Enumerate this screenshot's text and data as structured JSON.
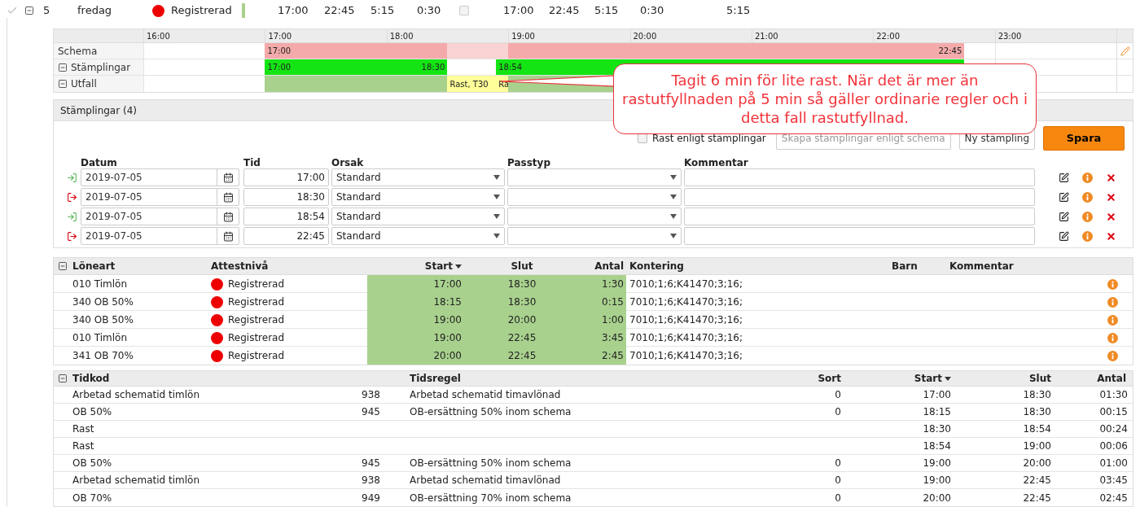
{
  "day_row": {
    "number": "5",
    "weekday": "fredag",
    "status": {
      "label": "Registrerad",
      "color": "#ee0000"
    },
    "times": [
      "17:00",
      "22:45",
      "5:15",
      "0:30"
    ],
    "checked": false,
    "times_2": [
      "17:00",
      "22:45",
      "5:15",
      "0:30"
    ],
    "total": "5:15"
  },
  "timeline": {
    "hours": [
      "16:00",
      "17:00",
      "18:00",
      "19:00",
      "20:00",
      "21:00",
      "22:00",
      "23:00"
    ],
    "rows": [
      {
        "label": "Schema",
        "collapsible": false,
        "segments": [
          {
            "kind": "schema",
            "label_start": "17:00"
          },
          {
            "kind": "schema_gap"
          },
          {
            "kind": "schema",
            "label_end": "22:45"
          }
        ]
      },
      {
        "label": "Stämplingar",
        "collapsible": true,
        "segments": [
          {
            "kind": "stamp",
            "label_start": "17:00",
            "label_end": "18:30"
          },
          {
            "kind": "stamp",
            "label_start": "18:54"
          }
        ]
      },
      {
        "label": "Utfall",
        "collapsible": true,
        "segments": [
          {
            "kind": "worked"
          },
          {
            "kind": "break",
            "label_start": "Rast, T30"
          },
          {
            "kind": "break",
            "label_start": "Ra"
          },
          {
            "kind": "worked"
          }
        ]
      }
    ]
  },
  "callout": {
    "text": "Tagit 6 min för lite rast. När det är mer än rastutfyllnaden på 5 min så gäller ordinarie regler och i detta fall rastutfyllnad."
  },
  "stamplingar": {
    "title": "Stämplingar (4)",
    "rast_checkbox": {
      "label": "Rast enligt stämplingar",
      "checked": false
    },
    "buttons": [
      {
        "label": "Skapa stämplingar enligt schema",
        "kind": "disabled"
      },
      {
        "label": "Ny stämpling",
        "kind": "secondary"
      },
      {
        "label": "Spara",
        "kind": "primary"
      }
    ],
    "columns": [
      "Datum",
      "Tid",
      "Orsak",
      "Passtyp",
      "Kommentar"
    ],
    "rows": [
      {
        "kind": "in",
        "date": "2019-07-05",
        "time": "17:00",
        "reason": "Standard"
      },
      {
        "kind": "out",
        "date": "2019-07-05",
        "time": "18:30",
        "reason": "Standard"
      },
      {
        "kind": "in",
        "date": "2019-07-05",
        "time": "18:54",
        "reason": "Standard"
      },
      {
        "kind": "out",
        "date": "2019-07-05",
        "time": "22:45",
        "reason": "Standard"
      }
    ]
  },
  "loneart": {
    "columns": [
      {
        "label": "Löneart",
        "sorted": false
      },
      {
        "label": "Attestnivå",
        "sorted": false
      },
      {
        "label": "Start",
        "sorted": true
      },
      {
        "label": "Slut",
        "sorted": false
      },
      {
        "label": "Antal",
        "sorted": false
      },
      {
        "label": "Kontering",
        "sorted": false
      },
      {
        "label": "Barn",
        "sorted": false
      },
      {
        "label": "Kommentar",
        "sorted": false
      }
    ],
    "rows": [
      {
        "code": "010 Timlön",
        "status": {
          "label": "Registrerad",
          "color": "#ee0000"
        },
        "start": "17:00",
        "slut": "18:30",
        "antal": "1:30",
        "kontering": "7010;1;6;K41470;3;16;"
      },
      {
        "code": "340 OB 50%",
        "status": {
          "label": "Registrerad",
          "color": "#ee0000"
        },
        "start": "18:15",
        "slut": "18:30",
        "antal": "0:15",
        "kontering": "7010;1;6;K41470;3;16;"
      },
      {
        "code": "340 OB 50%",
        "status": {
          "label": "Registrerad",
          "color": "#ee0000"
        },
        "start": "19:00",
        "slut": "20:00",
        "antal": "1:00",
        "kontering": "7010;1;6;K41470;3;16;"
      },
      {
        "code": "010 Timlön",
        "status": {
          "label": "Registrerad",
          "color": "#ee0000"
        },
        "start": "19:00",
        "slut": "22:45",
        "antal": "3:45",
        "kontering": "7010;1;6;K41470;3;16;"
      },
      {
        "code": "341 OB 70%",
        "status": {
          "label": "Registrerad",
          "color": "#ee0000"
        },
        "start": "20:00",
        "slut": "22:45",
        "antal": "2:45",
        "kontering": "7010;1;6;K41470;3;16;"
      }
    ]
  },
  "tidkod": {
    "columns": [
      {
        "label": "Tidkod",
        "sorted": false
      },
      {
        "label": "Tidsregel",
        "sorted": false
      },
      {
        "label": "Sort",
        "sorted": false
      },
      {
        "label": "Start",
        "sorted": true
      },
      {
        "label": "Slut",
        "sorted": false
      },
      {
        "label": "Antal",
        "sorted": false
      }
    ],
    "rows": [
      {
        "tidkod": "Arbetad schematid timlön",
        "regel_nr": "938",
        "regel": "Arbetad schematid timavlönad",
        "sort": "0",
        "start": "17:00",
        "slut": "18:30",
        "antal": "01:30"
      },
      {
        "tidkod": "OB 50%",
        "regel_nr": "945",
        "regel": "OB-ersättning 50% inom schema",
        "sort": "0",
        "start": "18:15",
        "slut": "18:30",
        "antal": "00:15"
      },
      {
        "tidkod": "Rast",
        "start": "18:30",
        "slut": "18:54",
        "antal": "00:24"
      },
      {
        "tidkod": "Rast",
        "start": "18:54",
        "slut": "19:00",
        "antal": "00:06"
      },
      {
        "tidkod": "OB 50%",
        "regel_nr": "945",
        "regel": "OB-ersättning 50% inom schema",
        "sort": "0",
        "start": "19:00",
        "slut": "20:00",
        "antal": "01:00"
      },
      {
        "tidkod": "Arbetad schematid timlön",
        "regel_nr": "938",
        "regel": "Arbetad schematid timavlönad",
        "sort": "0",
        "start": "19:00",
        "slut": "22:45",
        "antal": "03:45"
      },
      {
        "tidkod": "OB 70%",
        "regel_nr": "949",
        "regel": "OB-ersättning 70% inom schema",
        "sort": "0",
        "start": "20:00",
        "slut": "22:45",
        "antal": "02:45"
      }
    ]
  }
}
